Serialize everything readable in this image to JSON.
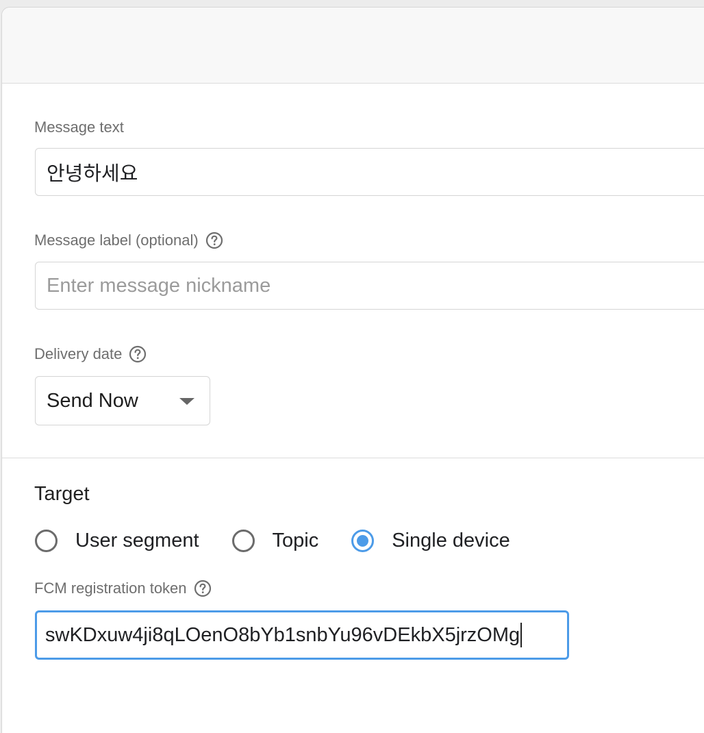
{
  "form": {
    "message_text": {
      "label": "Message text",
      "value": "안녕하세요"
    },
    "message_label": {
      "label": "Message label (optional)",
      "placeholder": "Enter message nickname",
      "value": ""
    },
    "delivery_date": {
      "label": "Delivery date",
      "selected": "Send Now"
    }
  },
  "target": {
    "title": "Target",
    "options": [
      {
        "label": "User segment",
        "checked": false
      },
      {
        "label": "Topic",
        "checked": false
      },
      {
        "label": "Single device",
        "checked": true
      }
    ],
    "token": {
      "label": "FCM registration token",
      "value": "swKDxuw4ji8qLOenO8bYb1snbYu96vDEkbX5jrzOMg"
    }
  },
  "colors": {
    "accent": "#4c9be8",
    "label_gray": "#6e6e6e",
    "border": "#d5d5d5"
  },
  "icons": {
    "help": "help-circle-icon",
    "dropdown": "caret-down-icon"
  }
}
